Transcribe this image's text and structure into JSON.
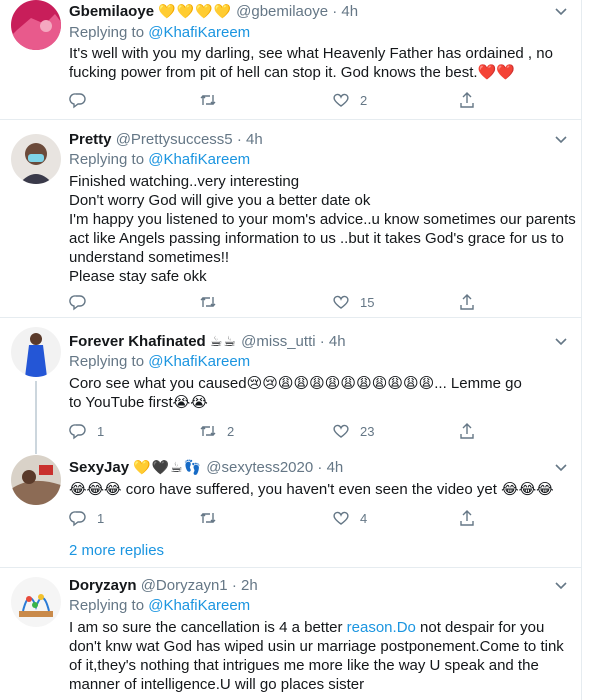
{
  "tweets": [
    {
      "name": "Gbemilaoye",
      "name_emoji": "💛💛💛💛",
      "handle": "@gbemilaoye",
      "dot": "·",
      "time": "4h",
      "replying_prefix": "Replying to",
      "replying_to": "@KhafiKareem",
      "lines": [
        "It's well with you my darling, see what Heavenly Father has ordained , no",
        "fucking power from pit of hell can stop it. God knows the best.❤️❤️"
      ],
      "replies": "",
      "retweets": "",
      "likes": "2"
    },
    {
      "name": "Pretty",
      "name_emoji": "",
      "handle": "@Prettysuccess5",
      "dot": "·",
      "time": "4h",
      "replying_prefix": "Replying to",
      "replying_to": "@KhafiKareem",
      "lines": [
        "Finished watching..very interesting",
        "Don't worry God will give you a better date ok",
        "I'm happy you listened to your mom's advice..u know sometimes our parents",
        "act like Angels passing information to us ..but it takes God's grace for us to",
        "understand sometimes!!",
        "Please stay safe okk"
      ],
      "replies": "",
      "retweets": "",
      "likes": "15"
    },
    {
      "name": "Forever Khafinated",
      "name_emoji": "☕☕",
      "handle": "@miss_utti",
      "dot": "·",
      "time": "4h",
      "replying_prefix": "Replying to",
      "replying_to": "@KhafiKareem",
      "lines": [
        "Coro see what you caused😢😢😩😩😩😩😩😩😩😩😩😩... Lemme go",
        "to YouTube first😭😭"
      ],
      "replies": "1",
      "retweets": "2",
      "likes": "23"
    },
    {
      "name": "SexyJay",
      "name_emoji": "💛🖤☕👣",
      "handle": "@sexytess2020",
      "dot": "·",
      "time": "4h",
      "replying_prefix": "",
      "replying_to": "",
      "lines": [
        "😂😂😂 coro have suffered, you haven't even seen the video yet 😂😂😂"
      ],
      "replies": "1",
      "retweets": "",
      "likes": "4"
    },
    {
      "name": "Doryzayn",
      "name_emoji": "",
      "handle": "@Doryzayn1",
      "dot": "·",
      "time": "2h",
      "replying_prefix": "Replying to",
      "replying_to": "@KhafiKareem",
      "line1_before": "I am so sure the cancellation is 4 a better ",
      "line1_link": "reason.Do",
      "line1_after": " not despair for you",
      "lines": [
        "don't knw wat God has wiped usin ur marriage postponement.Come to tink",
        "of it,they's nothing that intrigues me more like the way U speak and the",
        "manner of intelligence.U will go places sister"
      ]
    }
  ],
  "more_replies": "2 more replies",
  "colors": {
    "accent": "#1b95e0",
    "muted": "#657786",
    "border": "#e6ecf0"
  }
}
